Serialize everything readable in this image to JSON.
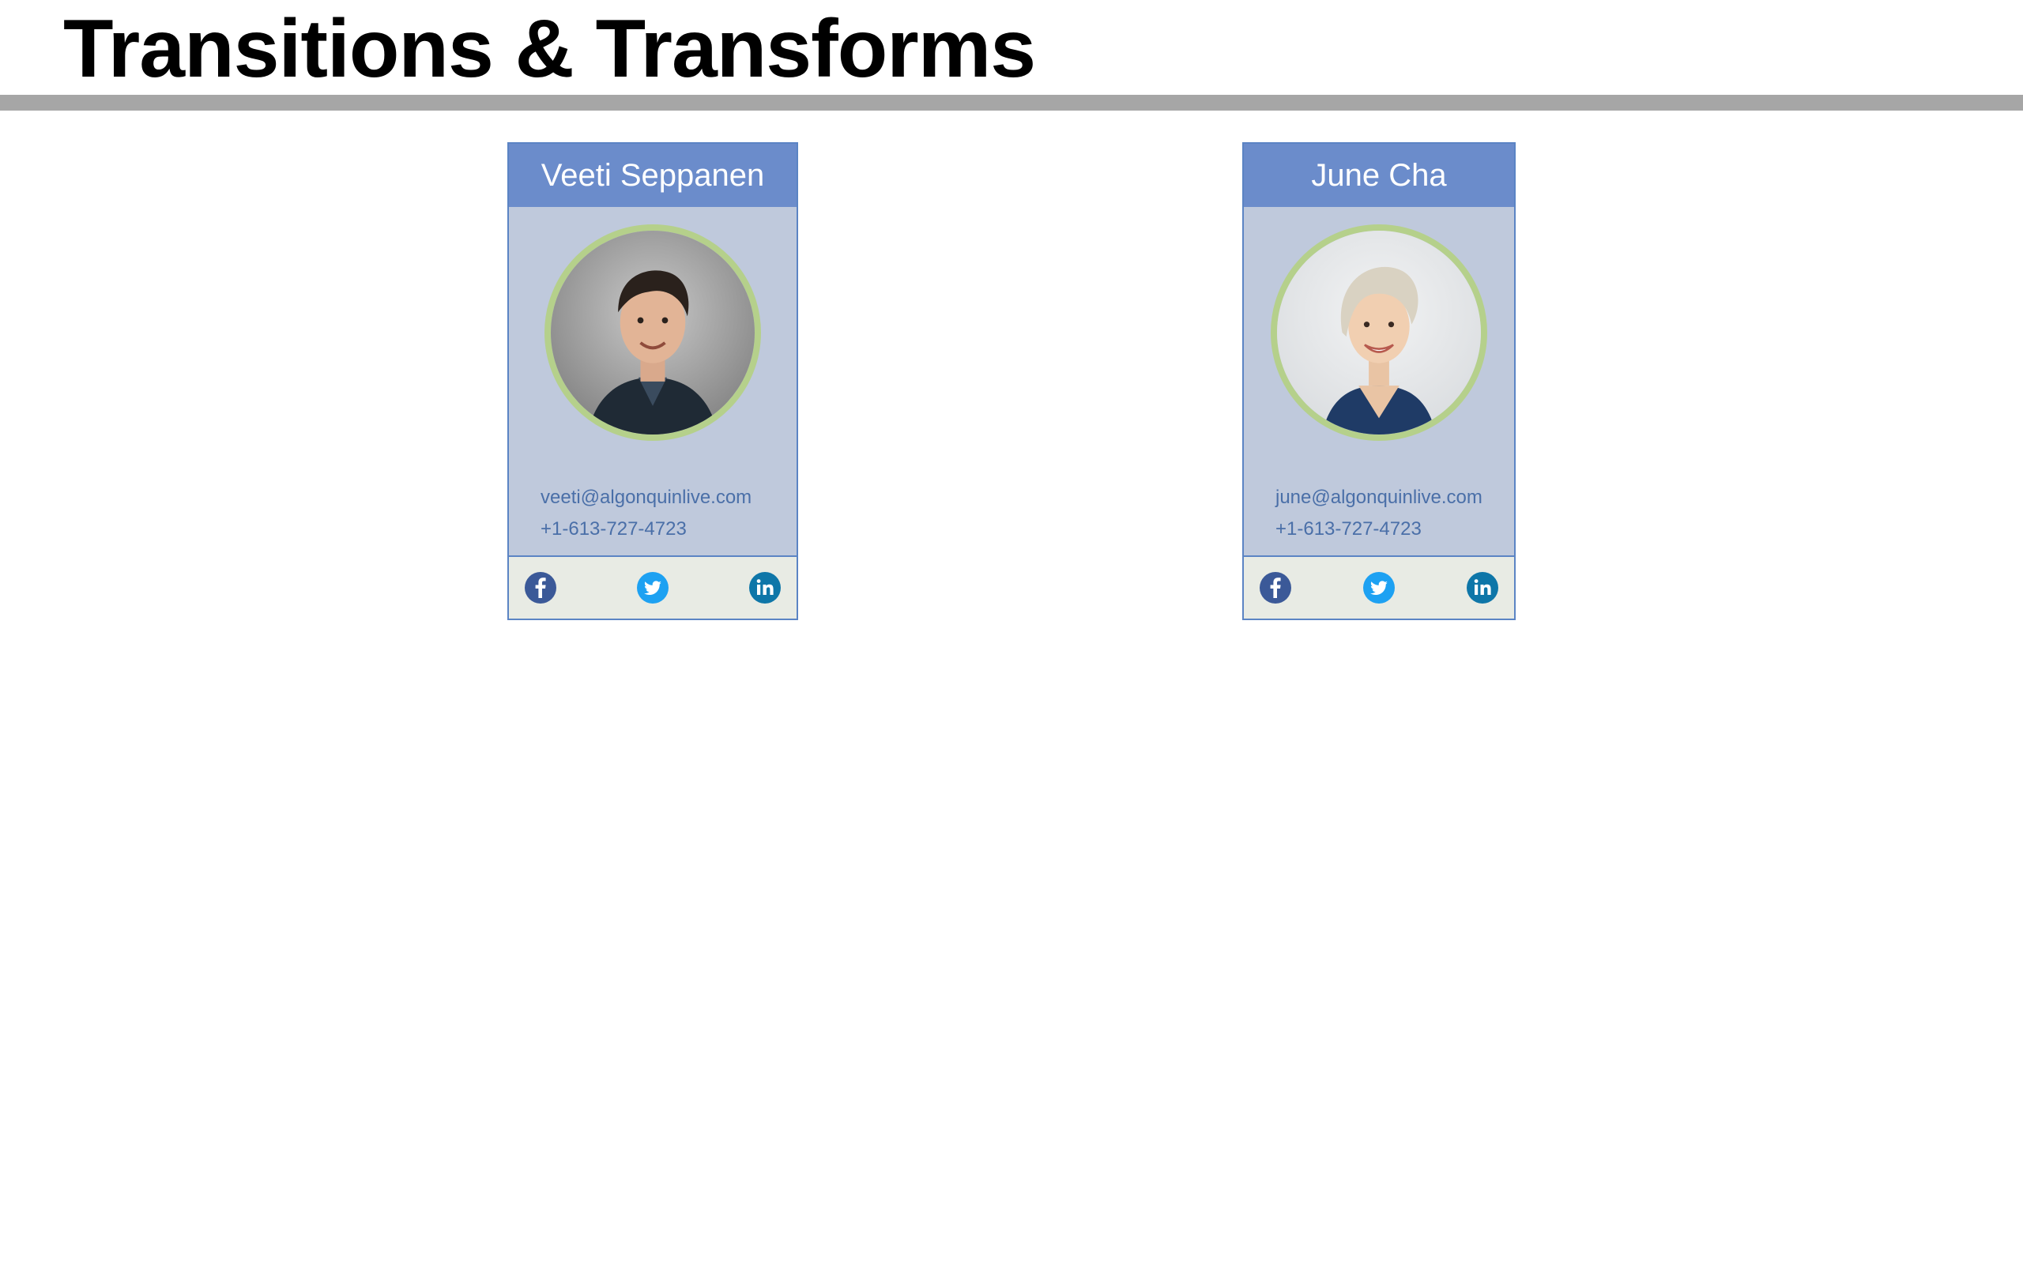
{
  "page": {
    "title": "Transitions & Transforms"
  },
  "colors": {
    "header_rule": "#a6a6a6",
    "card_header": "#6b8ccb",
    "card_body": "#bfc9dc",
    "card_border": "#5b84c4",
    "avatar_ring": "#b5d08b",
    "contact_text": "#4a6fa8",
    "social_bar": "#e8ebe4",
    "facebook": "#3b5998",
    "twitter": "#1da1f2",
    "linkedin": "#0e76a8"
  },
  "cards": [
    {
      "name": "Veeti Seppanen",
      "avatar": "portrait-photo-man",
      "email": "veeti@algonquinlive.com",
      "phone": "+1-613-727-4723",
      "social": [
        "facebook-icon",
        "twitter-icon",
        "linkedin-icon"
      ]
    },
    {
      "name": "June Cha",
      "avatar": "portrait-photo-woman",
      "email": "june@algonquinlive.com",
      "phone": "+1-613-727-4723",
      "social": [
        "facebook-icon",
        "twitter-icon",
        "linkedin-icon"
      ]
    }
  ]
}
